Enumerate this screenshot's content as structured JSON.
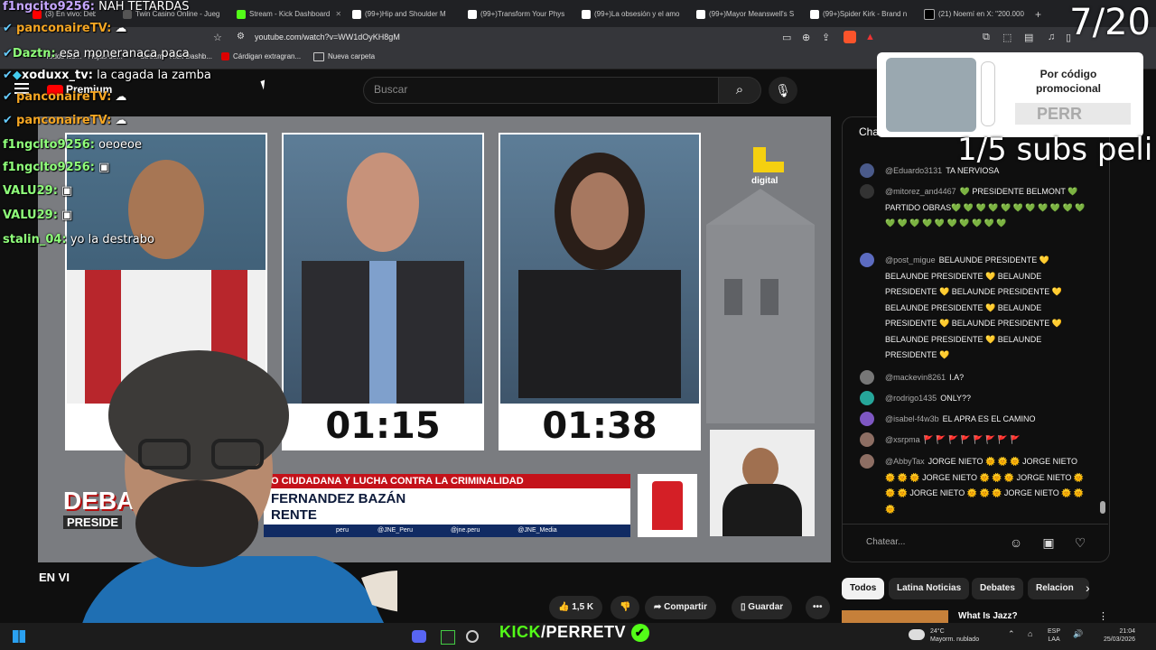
{
  "browser": {
    "tabs": [
      {
        "label": "(3) En vivo: Deb"
      },
      {
        "label": "Twin Casino Online - Jueg"
      },
      {
        "label": "Stream - Kick Dashboard"
      },
      {
        "label": "(99+)Hip and Shoulder M"
      },
      {
        "label": "(99+)Transform Your Phys"
      },
      {
        "label": "(99+)La obsesión y el amo"
      },
      {
        "label": "(99+)Mayor Meanswell's S"
      },
      {
        "label": "(99+)Spider Kirk - Brand n"
      },
      {
        "label": "(21) Noemí en X: \"200.000"
      }
    ],
    "new_tab": "+",
    "url": "youtube.com/watch?v=WW1dOyKH8gM",
    "bookmarks": [
      "Todos los... - Hojas de...",
      "Stream - Kick Dashb...",
      "Cárdigan extragran...",
      "Nueva carpeta"
    ]
  },
  "overlay": {
    "counter": "7/20",
    "subs_text": "1/5 subs peli",
    "top_message": {
      "user": "f1ngcito9256:",
      "text": "NAH TETARDAS"
    },
    "chat": [
      {
        "user": "panconaireTV:",
        "text": ""
      },
      {
        "user": "Daztn:",
        "text": "esa moneranaca paca"
      },
      {
        "user": "xoduxx_tv:",
        "text": "la cagada la zamba"
      },
      {
        "user": "panconaireTV:",
        "text": ""
      },
      {
        "user": "panconaireTV:",
        "text": ""
      },
      {
        "user": "f1ngclto9256:",
        "text": "oeoeoe"
      },
      {
        "user": "f1ngclto9256:",
        "text": ""
      },
      {
        "user": "VALU29:",
        "text": ""
      },
      {
        "user": "VALU29:",
        "text": ""
      },
      {
        "user": "stalin_04:",
        "text": "yo la destrabo"
      }
    ],
    "kick_brand": "KICK",
    "kick_slash": "/",
    "kick_name": "PERRETV"
  },
  "youtube": {
    "logo": "Premium",
    "search_placeholder": "Buscar",
    "search_icon": "search-icon",
    "mic_icon": "mic-icon",
    "live_label": "EN VI",
    "actions": {
      "like_count": "1,5 K",
      "share": "Compartir",
      "save": "Guardar",
      "more": "•••"
    },
    "chips": [
      "Todos",
      "Latina Noticias",
      "Debates",
      "Relacion"
    ],
    "next_video": "What Is Jazz?"
  },
  "video": {
    "timers": [
      "",
      "01:15",
      "01:38"
    ],
    "jne_brand": "digital",
    "lower_third_title": "O CIUDADANA Y LUCHA CONTRA LA CRIMINALIDAD",
    "lower_third_name": "FERNANDEZ BAZÁN",
    "lower_third_role": "RENTE",
    "social": [
      "peru",
      "@JNE_Peru",
      "@jne.peru",
      "@JNE_Media"
    ],
    "debate_label": "DEBA",
    "debate_sub": "PRESIDE"
  },
  "live_chat": {
    "title": "Chat de",
    "messages": [
      {
        "author": "@Eduardo3131",
        "text": "TA NERVIOSA",
        "avatar_color": "#4a5a8a"
      },
      {
        "author": "@mitorez_and4467",
        "text": "💚 PRESIDENTE BELMONT 💚 PARTIDO OBRAS💚 💚 💚 💚 💚 💚 💚 💚 💚 💚 💚 💚 💚 💚 💚 💚 💚 💚 💚 💚 💚",
        "avatar_color": "#333333"
      },
      {
        "author": "@post_migue",
        "text": "BELAUNDE PRESIDENTE 💛 BELAUNDE PRESIDENTE 💛 BELAUNDE PRESIDENTE 💛 BELAUNDE PRESIDENTE 💛 BELAUNDE PRESIDENTE 💛 BELAUNDE PRESIDENTE 💛 BELAUNDE PRESIDENTE 💛 BELAUNDE PRESIDENTE 💛 BELAUNDE PRESIDENTE 💛",
        "avatar_color": "#5c6bc0"
      },
      {
        "author": "@mackevin8261",
        "text": "I.A?",
        "avatar_color": "#777777"
      },
      {
        "author": "@rodrigo1435",
        "text": "ONLY??",
        "avatar_color": "#26a69a"
      },
      {
        "author": "@isabel-f4w3b",
        "text": "EL APRA ES EL CAMINO",
        "avatar_color": "#7e57c2"
      },
      {
        "author": "@xsrpma",
        "text": "🚩 🚩 🚩 🚩 🚩 🚩 🚩 🚩",
        "avatar_color": "#8d6e63"
      },
      {
        "author": "@AbbyTax",
        "text": "JORGE NIETO 🌞 🌞 🌞 JORGE NIETO 🌞 🌞 🌞 JORGE NIETO 🌞 🌞 🌞 JORGE NIETO 🌞 🌞 🌞 JORGE NIETO 🌞 🌞 🌞 JORGE NIETO 🌞 🌞 🌞",
        "avatar_color": "#8d6e63"
      }
    ],
    "input_placeholder": "Chatear...",
    "emoji_icon": "smiley-icon",
    "money_icon": "money-icon",
    "heart_icon": "heart-icon"
  },
  "promo": {
    "text": "Por código promocional",
    "code": "PERR"
  },
  "taskbar": {
    "weather_temp": "24°C",
    "weather_desc": "Mayorm. nublado",
    "lang_1": "ESP",
    "lang_2": "LAA",
    "time": "21:04",
    "date": "25/03/2026"
  },
  "colors": {
    "kick_green": "#53fc18",
    "youtube_red": "#ff0000",
    "lower_third_red": "#c4121a"
  }
}
